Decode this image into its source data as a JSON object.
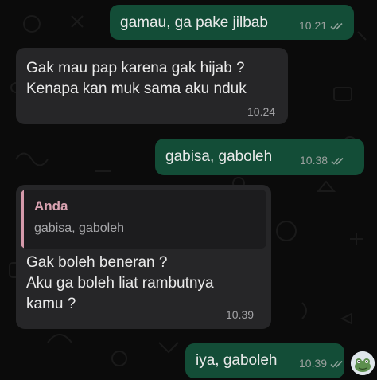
{
  "messages": [
    {
      "id": "m1",
      "direction": "outgoing",
      "text": "gamau, ga pake jilbab",
      "time": "10.21",
      "status": "read"
    },
    {
      "id": "m2",
      "direction": "incoming",
      "text": "Gak mau pap karena gak hijab ?\nKenapa kan muk sama aku nduk",
      "time": "10.24"
    },
    {
      "id": "m3",
      "direction": "outgoing",
      "text": "gabisa, gaboleh",
      "time": "10.38",
      "status": "read"
    },
    {
      "id": "m4",
      "direction": "incoming",
      "text": "Gak boleh beneran ?\nAku ga boleh liat rambutnya\nkamu ?",
      "time": "10.39",
      "quote": {
        "author": "Anda",
        "text": "gabisa, gaboleh"
      }
    },
    {
      "id": "m5",
      "direction": "outgoing",
      "text": "iya, gaboleh",
      "time": "10.39",
      "status": "read"
    }
  ],
  "colors": {
    "outgoing_bubble": "#134d37",
    "incoming_bubble": "#262628",
    "quote_accent": "#d59aab",
    "background": "#0b0b0b"
  },
  "icons": {
    "read_receipt": "double-check-icon",
    "profile": "avatar-frog-sticker"
  }
}
